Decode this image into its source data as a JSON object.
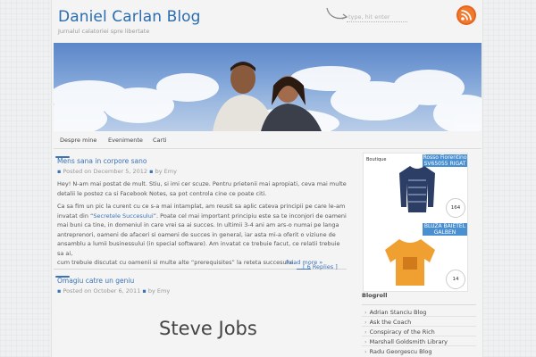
{
  "header": {
    "title": "Daniel Carlan Blog",
    "tagline": "Jurnalul calatoriei spre libertate",
    "search_placeholder": "type, hit enter"
  },
  "nav": {
    "items": [
      {
        "label": "Despre mine"
      },
      {
        "label": "Evenimente"
      },
      {
        "label": "Carti"
      }
    ]
  },
  "posts": [
    {
      "title": "Mens sana in corpore sano",
      "meta_prefix": "Posted on December 5, 2012",
      "meta_by": "by Emy",
      "para1_line1": "Hey! N-am mai postat de mult. Stiu, si imi cer scuze. Pentru prietenii mai apropiati, ceva mai multe",
      "para1_line2": "detalii le postez ca si Facebook Notes, sa pot controla cine ce poate citi.",
      "para2_line1": "Ca sa fim un pic la curent cu ce s-a mai intamplat, am reusit sa aplic cateva principii pe care le-am",
      "para2_line2_pre": "invatat din “",
      "para2_link": "Secretele Succesului",
      "para2_line2_post": "”. Poate cel mai important principiu este sa te inconjori de oameni",
      "para2_line3": "mai buni ca tine, in domeniul in care vrei sa ai succes. In ultimii 3-4 ani am ars-o numai pe langa",
      "para2_line4": "antreprenori, oameni de afaceri si oameni de succes in general, iar asta mi-a oferit o viziune de",
      "para2_line5": "ansamblu a lumii businessului (in special software). Am invatat ce trebuie facut, ce relatii trebuie sa ai,",
      "para2_line6": "cum trebuie discutat cu oamenii si multe alte “prerequisites” la reteta succesului.",
      "read_more": "Read more »",
      "comments": "[ 6 Replies ]"
    },
    {
      "title": "Omagiu catre un geniu",
      "meta_prefix": "Posted on October 6, 2011",
      "meta_by": "by Emy",
      "image_text": "Steve Jobs"
    }
  ],
  "sidebar": {
    "ads": [
      {
        "label_line1": "Rosso Fiorentino",
        "label_line2": "SV65055 RIGAT",
        "price": "164",
        "brand": "Boutique"
      },
      {
        "label_line1": "BLUZA BAIETEL",
        "label_line2": "GALBEN",
        "price": "14"
      }
    ],
    "blogroll_title": "Blogroll",
    "blogroll": [
      "Adrian Stanciu Blog",
      "Ask the Coach",
      "Conspiracy of the Rich",
      "Marshall Goldsmith Library",
      "Radu Georgescu Blog"
    ]
  },
  "colors": {
    "accent": "#2a6db0",
    "rss": "#e8641c",
    "ad_label": "#4a90d0"
  }
}
